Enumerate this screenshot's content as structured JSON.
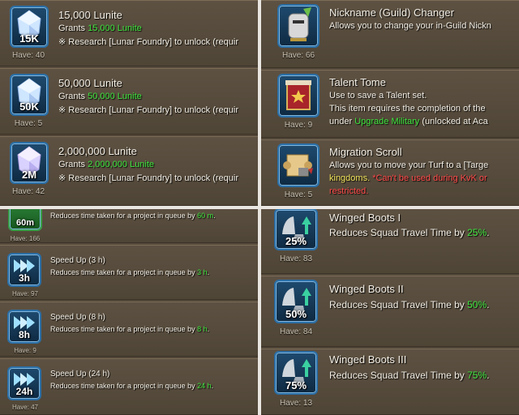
{
  "lunite": {
    "items": [
      {
        "badge": "15K",
        "have": "Have: 40",
        "title": "15,000 Lunite",
        "grants_label": "Grants ",
        "grants_value": "15,000 Lunite",
        "req": "※ Research [Lunar Foundry] to unlock (requir"
      },
      {
        "badge": "50K",
        "have": "Have: 5",
        "title": "50,000 Lunite",
        "grants_label": "Grants ",
        "grants_value": "50,000 Lunite",
        "req": "※ Research [Lunar Foundry] to unlock (requir"
      },
      {
        "badge": "2M",
        "have": "Have: 42",
        "title": "2,000,000 Lunite",
        "grants_label": "Grants ",
        "grants_value": "2,000,000 Lunite",
        "req": "※ Research [Lunar Foundry] to unlock (requir"
      }
    ]
  },
  "special": {
    "nickname": {
      "have": "Have: 66",
      "title": "Nickname (Guild) Changer",
      "desc": "Allows you to change your in-Guild Nickn"
    },
    "talent": {
      "have": "Have: 9",
      "title": "Talent Tome",
      "line1": "Use to save a Talent set.",
      "line2": "This item requires the completion of the",
      "line3_pre": "under ",
      "line3_green": "Upgrade Military",
      "line3_post": " (unlocked at Aca"
    },
    "migration": {
      "have": "Have: 5",
      "title": "Migration Scroll",
      "line1": "Allows you to move your Turf to a [Targe",
      "line2_yellow": "kingdoms.",
      "line2_red": " *Can't be used during KvK or",
      "line3_red": "restricted."
    }
  },
  "speedups": {
    "partial": {
      "badge": "60m",
      "have": "Have: 166",
      "desc_pre": "Reduces time taken for a project in queue by ",
      "desc_val": "60 m",
      "desc_post": "."
    },
    "items": [
      {
        "badge": "3h",
        "have": "Have: 97",
        "title": "Speed Up (3 h)",
        "desc_pre": "Reduces time taken for a project in queue by ",
        "desc_val": "3 h",
        "desc_post": "."
      },
      {
        "badge": "8h",
        "have": "Have: 9",
        "title": "Speed Up (8 h)",
        "desc_pre": "Reduces time taken for a project in queue by ",
        "desc_val": "8 h",
        "desc_post": "."
      },
      {
        "badge": "24h",
        "have": "Have: 47",
        "title": "Speed Up (24 h)",
        "desc_pre": "Reduces time taken for a project in queue by ",
        "desc_val": "24 h",
        "desc_post": "."
      }
    ]
  },
  "boots": {
    "items": [
      {
        "badge": "25%",
        "have": "Have: 83",
        "title": "Winged Boots I",
        "desc_pre": "Reduces Squad Travel Time by ",
        "desc_val": "25%",
        "desc_post": "."
      },
      {
        "badge": "50%",
        "have": "Have: 84",
        "title": "Winged Boots II",
        "desc_pre": "Reduces Squad Travel Time by ",
        "desc_val": "50%",
        "desc_post": "."
      },
      {
        "badge": "75%",
        "have": "Have: 13",
        "title": "Winged Boots III",
        "desc_pre": "Reduces Squad Travel Time by ",
        "desc_val": "75%",
        "desc_post": "."
      }
    ]
  },
  "colors": {
    "highlight_green": "#3ee63e",
    "warning_red": "#ff4a4a",
    "keyword_yellow": "#f2e45c",
    "icon_border": "#2c6fa6",
    "panel_bg": "#54493a"
  }
}
